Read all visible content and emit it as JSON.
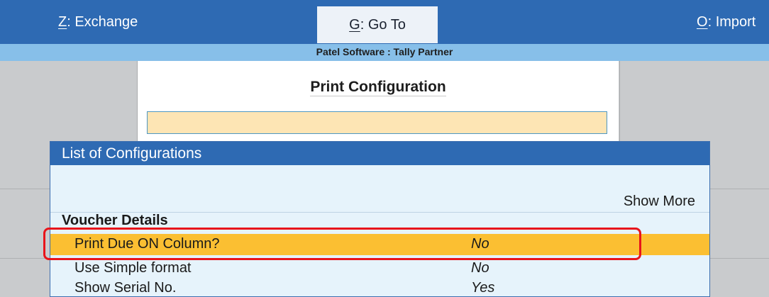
{
  "topbar": {
    "exchange": {
      "key": "Z",
      "label": "Exchange"
    },
    "goto": {
      "key": "G",
      "label": "Go To"
    },
    "import": {
      "key": "O",
      "label": "Import"
    }
  },
  "subbar": {
    "title": "Patel Software : Tally Partner"
  },
  "print_config": {
    "title": "Print Configuration",
    "input_value": ""
  },
  "config_list": {
    "title": "List of Configurations",
    "show_more": "Show More",
    "section": "Voucher Details",
    "items": [
      {
        "label": "Print Due ON Column?",
        "value": "No"
      },
      {
        "label": "Use Simple format",
        "value": "No"
      },
      {
        "label": "Show Serial No.",
        "value": "Yes"
      }
    ]
  },
  "colors": {
    "topbar": "#2e6ab3",
    "subbar": "#87bfe9",
    "highlight": "#fbbf32",
    "input_bg": "#fde5b4",
    "annotation": "#e8141b"
  }
}
